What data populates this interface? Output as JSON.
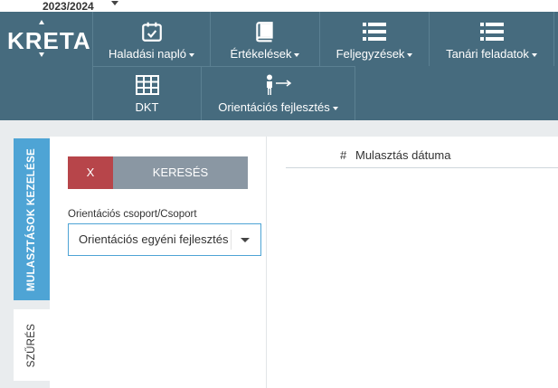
{
  "header": {
    "school_year": "2023/2024",
    "logo": "KRETA"
  },
  "nav": {
    "items": [
      {
        "label": "Haladási napló",
        "icon": "calendar-check-icon"
      },
      {
        "label": "Értékelések",
        "icon": "book-icon"
      },
      {
        "label": "Feljegyzések",
        "icon": "list-icon"
      },
      {
        "label": "Tanári feladatok",
        "icon": "list-icon"
      },
      {
        "label": "DKT",
        "icon": "table-icon"
      },
      {
        "label": "Orientációs fejlesztés",
        "icon": "person-arrow-icon"
      }
    ]
  },
  "side_tabs": {
    "active": "MULASZTÁSOK KEZELÉSE",
    "other": "SZŰRÉS"
  },
  "filter": {
    "clear_label": "X",
    "search_label": "KERESÉS",
    "group_label": "Orientációs csoport/Csoport",
    "group_value": "Orientációs egyéni fejlesztés"
  },
  "grid": {
    "row_num_header": "#",
    "columns": [
      "Mulasztás dátuma"
    ]
  },
  "colors": {
    "nav_bg": "#466b7e",
    "tab_active": "#4ea4d5",
    "clear_btn": "#b7454a",
    "search_btn": "#8a97a3"
  }
}
